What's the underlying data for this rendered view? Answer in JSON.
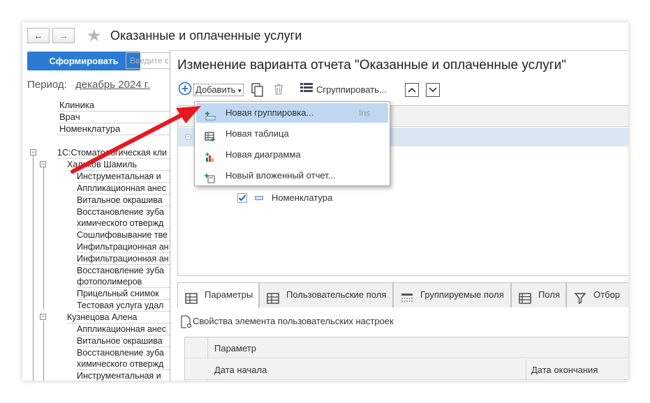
{
  "background_window": {
    "title": "Оказанные и оплаченные услуги",
    "nav_back_icon": "arrow-left-icon",
    "nav_forward_icon": "arrow-right-icon",
    "favorite_icon": "star-icon",
    "generate_button": "Сформировать",
    "search_placeholder": "Введите с",
    "period_label": "Период:",
    "period_value": "декабрь 2024 г.",
    "header_rows": [
      "Клиника",
      "Врач",
      "Номенклатура"
    ],
    "clinic": "1С:Стоматологическая кли",
    "doctors": [
      {
        "name": "Халиков Шамиль",
        "services": [
          "Инструментальная и",
          "Аппликационная анес",
          "Витальное окрашива",
          "Восстановление зуба",
          "химического отвержд",
          "Сошлифовывание тве",
          "Инфильтрационная ан",
          "Инфильтрационная ан",
          "Восстановление зуба",
          "фотополимеров",
          "Прицельный снимок",
          "Тестовая услуга удал"
        ]
      },
      {
        "name": "Кузнецова Алена",
        "services": [
          "Аппликационная анес",
          "Витальное окрашива",
          "Восстановление зуба",
          "химического отвержд",
          "Инструментальная и"
        ]
      }
    ]
  },
  "dialog": {
    "title": "Изменение варианта отчета \"Оказанные и оплаченные услуги\"",
    "toolbar": {
      "add_label": "Добавить",
      "add_icon": "plus-circle-icon",
      "copy_icon": "copy-icon",
      "delete_icon": "trash-icon",
      "group_label": "Сгруппировать...",
      "group_icon": "list-icon",
      "move_up_icon": "chevron-up-icon",
      "move_down_icon": "chevron-down-icon"
    },
    "grid": {
      "field_label": "Номенклатура",
      "field_checked": true
    },
    "menu": {
      "items": [
        {
          "label": "Новая группировка...",
          "shortcut": "Ins",
          "icon": "new-grouping-icon"
        },
        {
          "label": "Новая таблица",
          "shortcut": "",
          "icon": "new-table-icon"
        },
        {
          "label": "Новая диаграмма",
          "shortcut": "",
          "icon": "new-chart-icon"
        },
        {
          "label": "Новый вложенный отчет...",
          "shortcut": "",
          "icon": "new-nested-report-icon"
        }
      ]
    },
    "tabs": [
      {
        "label": "Параметры",
        "icon": "table-icon"
      },
      {
        "label": "Пользовательские поля",
        "icon": "table-icon"
      },
      {
        "label": "Группируемые поля",
        "icon": "grouping-fields-icon"
      },
      {
        "label": "Поля",
        "icon": "list-icon"
      },
      {
        "label": "Отбор",
        "icon": "filter-icon"
      }
    ],
    "props_label": "Свойства элемента пользовательских настроек",
    "props_table": {
      "param_header": "Параметр",
      "start_header": "Дата начала",
      "end_header": "Дата окончания"
    }
  },
  "colors": {
    "accent_button": "#2b7bd3",
    "menu_highlight": "#bfd7f1",
    "annotation_arrow": "#e8171f"
  }
}
